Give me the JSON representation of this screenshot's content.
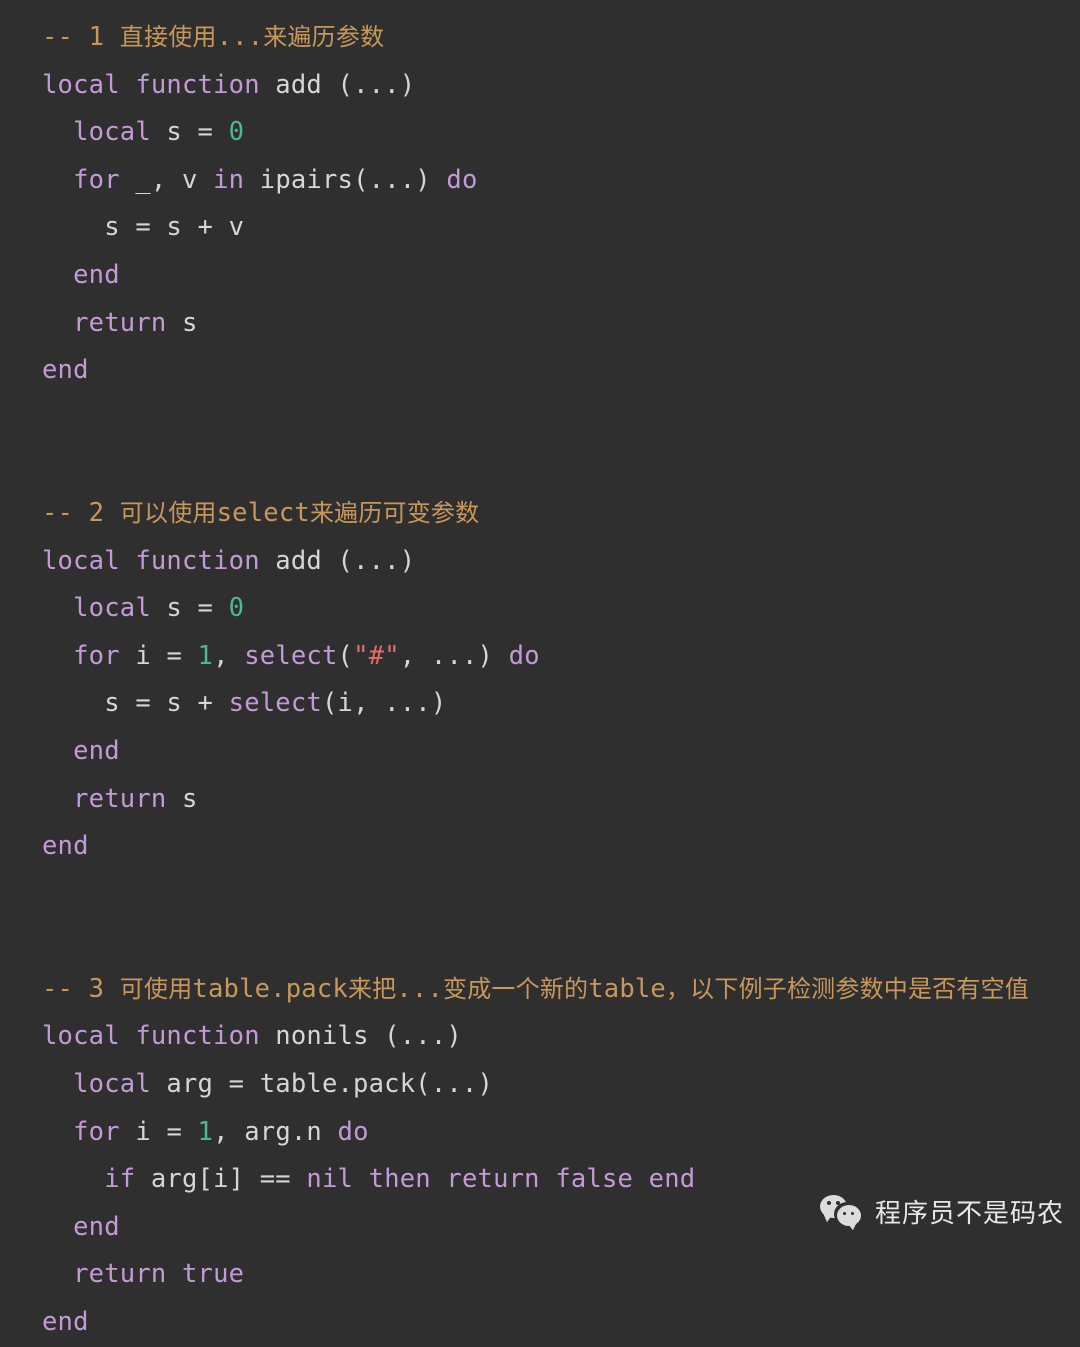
{
  "document": {
    "language": "lua",
    "background_color": "#2f2f2f",
    "theme": {
      "comment_color": "#c8975a",
      "keyword_color": "#c49ad6",
      "number_color": "#4bb79a",
      "string_color": "#e06c6c",
      "text_color": "#d6d6d6"
    }
  },
  "code": {
    "blocks": [
      {
        "id": "block-1",
        "comment_number": "1",
        "comment_text": "-- 1 直接使用...来遍历参数",
        "lines": [
          "-- 1 直接使用...来遍历参数",
          "local function add (...)",
          "  local s = 0",
          "  for _, v in ipairs(...) do",
          "    s = s + v",
          "  end",
          "  return s",
          "end"
        ]
      },
      {
        "id": "block-2",
        "comment_number": "2",
        "comment_text": "-- 2 可以使用select来遍历可变参数",
        "lines": [
          "-- 2 可以使用select来遍历可变参数",
          "local function add (...)",
          "  local s = 0",
          "  for i = 1, select(\"#\", ...) do",
          "    s = s + select(i, ...)",
          "  end",
          "  return s",
          "end"
        ]
      },
      {
        "id": "block-3",
        "comment_number": "3",
        "comment_text": "-- 3 可使用table.pack来把...变成一个新的table，以下例子检测参数中是否有空值",
        "lines": [
          "-- 3 可使用table.pack来把...变成一个新的table，以下例子检测参数中是否有空值",
          "local function nonils (...)",
          "  local arg = table.pack(...)",
          "  for i = 1, arg.n do",
          "    if arg[i] == nil then return false end",
          "  end",
          "  return true",
          "end"
        ]
      }
    ],
    "line_tokens": [
      [
        {
          "t": "-- ",
          "c": "comment"
        },
        {
          "t": "1",
          "c": "comment"
        },
        {
          "t": " ",
          "c": "comment"
        },
        {
          "t": "直接使用",
          "c": "comment-cjk"
        },
        {
          "t": "...",
          "c": "comment"
        },
        {
          "t": "来遍历参数",
          "c": "comment-cjk"
        }
      ],
      [
        {
          "t": "local",
          "c": "keyword"
        },
        {
          "t": " ",
          "c": "plain"
        },
        {
          "t": "function",
          "c": "keyword"
        },
        {
          "t": " add (...)",
          "c": "plain"
        }
      ],
      [
        {
          "t": "  ",
          "c": "plain"
        },
        {
          "t": "local",
          "c": "keyword"
        },
        {
          "t": " s = ",
          "c": "plain"
        },
        {
          "t": "0",
          "c": "number"
        }
      ],
      [
        {
          "t": "  ",
          "c": "plain"
        },
        {
          "t": "for",
          "c": "keyword"
        },
        {
          "t": " _, v ",
          "c": "plain"
        },
        {
          "t": "in",
          "c": "keyword"
        },
        {
          "t": " ipairs(...) ",
          "c": "plain"
        },
        {
          "t": "do",
          "c": "keyword"
        }
      ],
      [
        {
          "t": "    s = s + v",
          "c": "plain"
        }
      ],
      [
        {
          "t": "  ",
          "c": "plain"
        },
        {
          "t": "end",
          "c": "keyword"
        }
      ],
      [
        {
          "t": "  ",
          "c": "plain"
        },
        {
          "t": "return",
          "c": "keyword"
        },
        {
          "t": " s",
          "c": "plain"
        }
      ],
      [
        {
          "t": "end",
          "c": "keyword"
        }
      ],
      [],
      [],
      [
        {
          "t": "-- ",
          "c": "comment"
        },
        {
          "t": "2",
          "c": "comment"
        },
        {
          "t": " ",
          "c": "comment"
        },
        {
          "t": "可以使用",
          "c": "comment-cjk"
        },
        {
          "t": "select",
          "c": "comment"
        },
        {
          "t": "来遍历可变参数",
          "c": "comment-cjk"
        }
      ],
      [
        {
          "t": "local",
          "c": "keyword"
        },
        {
          "t": " ",
          "c": "plain"
        },
        {
          "t": "function",
          "c": "keyword"
        },
        {
          "t": " add (...)",
          "c": "plain"
        }
      ],
      [
        {
          "t": "  ",
          "c": "plain"
        },
        {
          "t": "local",
          "c": "keyword"
        },
        {
          "t": " s = ",
          "c": "plain"
        },
        {
          "t": "0",
          "c": "number"
        }
      ],
      [
        {
          "t": "  ",
          "c": "plain"
        },
        {
          "t": "for",
          "c": "keyword"
        },
        {
          "t": " i = ",
          "c": "plain"
        },
        {
          "t": "1",
          "c": "number"
        },
        {
          "t": ", ",
          "c": "plain"
        },
        {
          "t": "select",
          "c": "func"
        },
        {
          "t": "(",
          "c": "plain"
        },
        {
          "t": "\"#\"",
          "c": "string"
        },
        {
          "t": ", ...) ",
          "c": "plain"
        },
        {
          "t": "do",
          "c": "keyword"
        }
      ],
      [
        {
          "t": "    s = s + ",
          "c": "plain"
        },
        {
          "t": "select",
          "c": "func"
        },
        {
          "t": "(i, ...)",
          "c": "plain"
        }
      ],
      [
        {
          "t": "  ",
          "c": "plain"
        },
        {
          "t": "end",
          "c": "keyword"
        }
      ],
      [
        {
          "t": "  ",
          "c": "plain"
        },
        {
          "t": "return",
          "c": "keyword"
        },
        {
          "t": " s",
          "c": "plain"
        }
      ],
      [
        {
          "t": "end",
          "c": "keyword"
        }
      ],
      [],
      [],
      [
        {
          "t": "-- ",
          "c": "comment"
        },
        {
          "t": "3",
          "c": "comment"
        },
        {
          "t": " ",
          "c": "comment"
        },
        {
          "t": "可使用",
          "c": "comment-cjk"
        },
        {
          "t": "table.pack",
          "c": "comment"
        },
        {
          "t": "来把",
          "c": "comment-cjk"
        },
        {
          "t": "...",
          "c": "comment"
        },
        {
          "t": "变成一个新的",
          "c": "comment-cjk"
        },
        {
          "t": "table",
          "c": "comment"
        },
        {
          "t": "，以下例子检测参数中是否有空值",
          "c": "comment-cjk"
        }
      ],
      [
        {
          "t": "local",
          "c": "keyword"
        },
        {
          "t": " ",
          "c": "plain"
        },
        {
          "t": "function",
          "c": "keyword"
        },
        {
          "t": " nonils (...)",
          "c": "plain"
        }
      ],
      [
        {
          "t": "  ",
          "c": "plain"
        },
        {
          "t": "local",
          "c": "keyword"
        },
        {
          "t": " arg = table.pack(...)",
          "c": "plain"
        }
      ],
      [
        {
          "t": "  ",
          "c": "plain"
        },
        {
          "t": "for",
          "c": "keyword"
        },
        {
          "t": " i = ",
          "c": "plain"
        },
        {
          "t": "1",
          "c": "number"
        },
        {
          "t": ", arg.n ",
          "c": "plain"
        },
        {
          "t": "do",
          "c": "keyword"
        }
      ],
      [
        {
          "t": "    ",
          "c": "plain"
        },
        {
          "t": "if",
          "c": "keyword"
        },
        {
          "t": " arg[i] == ",
          "c": "plain"
        },
        {
          "t": "nil",
          "c": "keyword"
        },
        {
          "t": " ",
          "c": "plain"
        },
        {
          "t": "then",
          "c": "keyword"
        },
        {
          "t": " ",
          "c": "plain"
        },
        {
          "t": "return",
          "c": "keyword"
        },
        {
          "t": " ",
          "c": "plain"
        },
        {
          "t": "false",
          "c": "keyword"
        },
        {
          "t": " ",
          "c": "plain"
        },
        {
          "t": "end",
          "c": "keyword"
        }
      ],
      [
        {
          "t": "  ",
          "c": "plain"
        },
        {
          "t": "end",
          "c": "keyword"
        }
      ],
      [
        {
          "t": "  ",
          "c": "plain"
        },
        {
          "t": "return",
          "c": "keyword"
        },
        {
          "t": " ",
          "c": "plain"
        },
        {
          "t": "true",
          "c": "keyword"
        }
      ],
      [
        {
          "t": "end",
          "c": "keyword"
        }
      ]
    ]
  },
  "watermark": {
    "label": "程序员不是码农",
    "logo_icon": "wechat-icon"
  }
}
